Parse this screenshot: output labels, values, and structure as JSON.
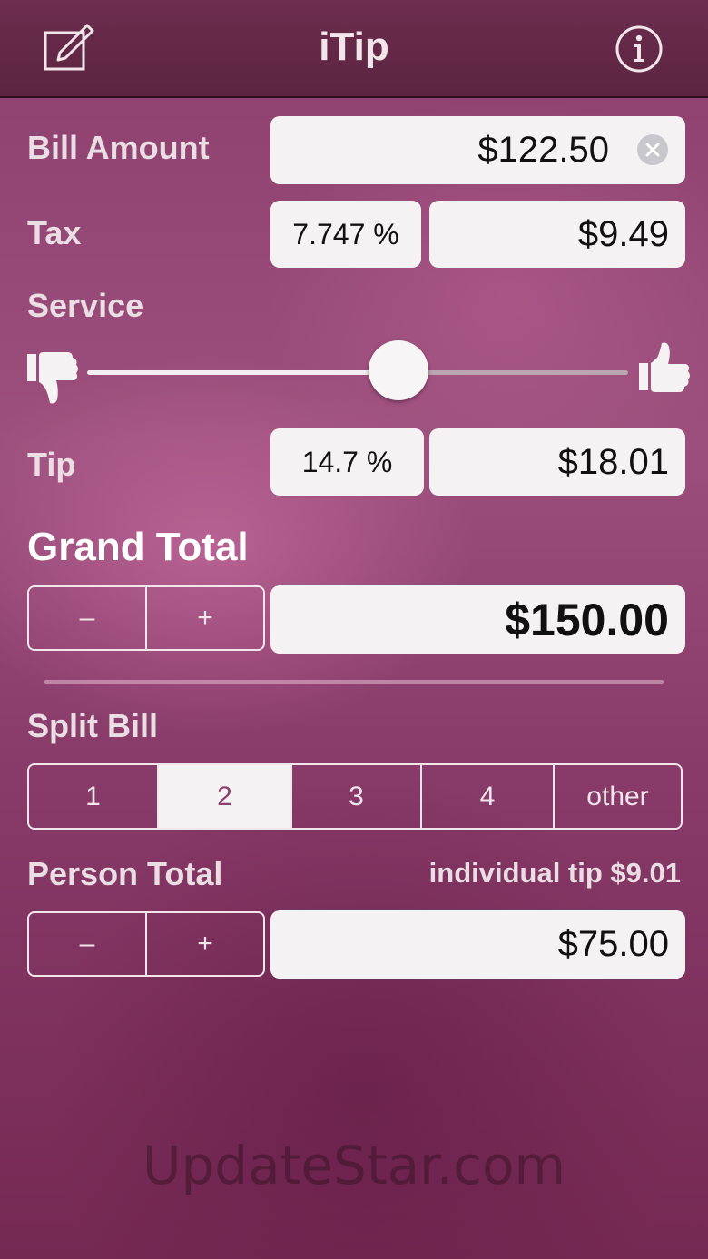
{
  "app": {
    "title": "iTip"
  },
  "icons": {
    "edit": "edit-icon",
    "info": "info-icon",
    "thumbs_down": "thumbs-down-icon",
    "thumbs_up": "thumbs-up-icon",
    "clear": "clear-icon"
  },
  "colors": {
    "navbar": "#5b243f",
    "background": "#8c3f6d",
    "field": "#f5f2f3",
    "selected_text": "#8c3f6d"
  },
  "bill": {
    "label": "Bill Amount",
    "value": "$122.50"
  },
  "tax": {
    "label": "Tax",
    "percent": "7.747 %",
    "amount": "$9.49"
  },
  "service": {
    "label": "Service",
    "slider_level_percent": 50
  },
  "tip": {
    "label": "Tip",
    "percent": "14.7 %",
    "amount": "$18.01"
  },
  "grand_total": {
    "label": "Grand Total",
    "minus": "–",
    "plus": "+",
    "value": "$150.00"
  },
  "split": {
    "label": "Split Bill",
    "options": [
      "1",
      "2",
      "3",
      "4",
      "other"
    ],
    "selected": "2"
  },
  "person_total": {
    "label": "Person Total",
    "individual_tip": "individual tip $9.01",
    "minus": "–",
    "plus": "+",
    "value": "$75.00"
  },
  "watermark": "UpdateStar.com"
}
